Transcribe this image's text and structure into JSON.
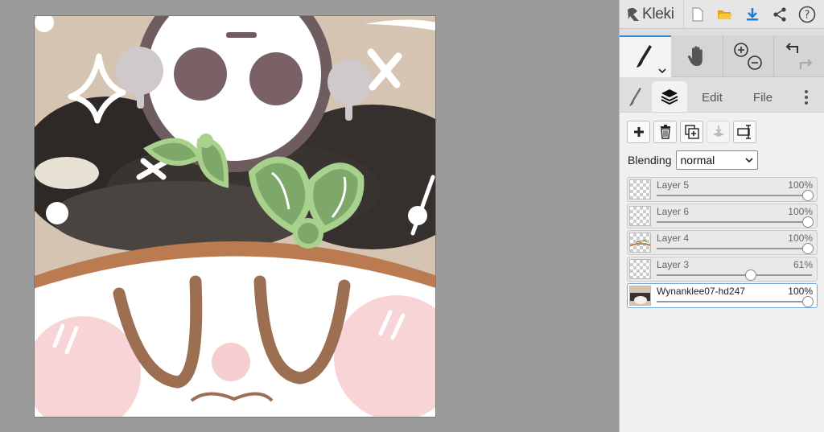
{
  "app": {
    "name": "Kleki"
  },
  "toolbar": {
    "icons": [
      "new-file-icon",
      "open-folder-icon",
      "download-icon",
      "share-icon",
      "help-icon"
    ],
    "help_glyph": "?"
  },
  "tools": {
    "active": "brush",
    "items": [
      "brush-tool-icon",
      "hand-tool-icon",
      "zoom-in-icon",
      "zoom-out-icon",
      "undo-icon",
      "redo-icon"
    ]
  },
  "tabs": {
    "edit_label": "Edit",
    "file_label": "File",
    "active": "layers"
  },
  "layers_panel": {
    "blending_label": "Blending",
    "blending_value": "normal",
    "layers": [
      {
        "name": "Layer 5",
        "opacity_label": "100%",
        "opacity": 1.0,
        "selected": false
      },
      {
        "name": "Layer 6",
        "opacity_label": "100%",
        "opacity": 1.0,
        "selected": false
      },
      {
        "name": "Layer 4",
        "opacity_label": "100%",
        "opacity": 1.0,
        "selected": false
      },
      {
        "name": "Layer 3",
        "opacity_label": "61%",
        "opacity": 0.61,
        "selected": false
      },
      {
        "name": "Wynanklee07-hd247",
        "opacity_label": "100%",
        "opacity": 1.0,
        "selected": true
      }
    ]
  },
  "colors": {
    "accent": "#2f8be0",
    "panel_bg": "#dedede",
    "workspace_bg": "#9b9b9b"
  }
}
